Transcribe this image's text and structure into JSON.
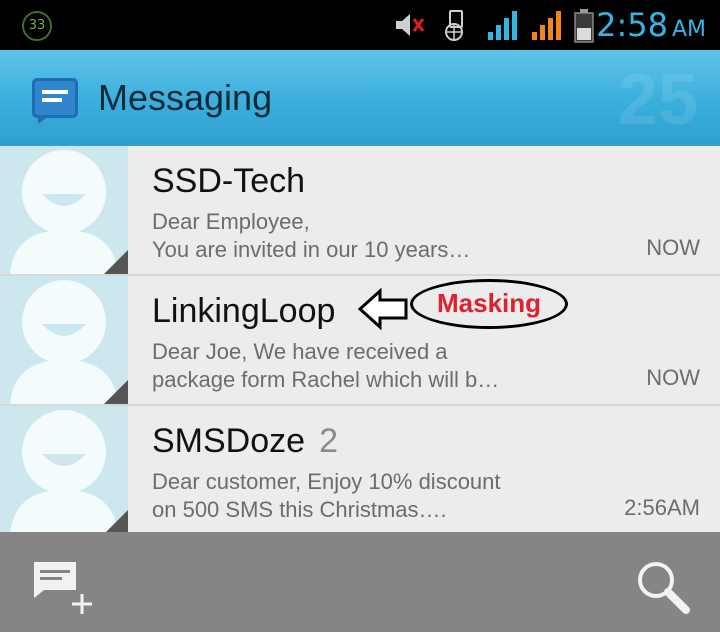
{
  "status_bar": {
    "badge": "33",
    "time": "2:58",
    "ampm": "AM",
    "icons": [
      "mute-icon",
      "data-icon",
      "signal-1-icon",
      "signal-2-icon",
      "battery-icon"
    ]
  },
  "action_bar": {
    "title": "Messaging",
    "ghost_count": "25",
    "icon": "messaging-app-icon"
  },
  "conversations": [
    {
      "sender": "SSD-Tech",
      "unread": "",
      "preview_line1": "Dear Employee,",
      "preview_line2": "You are invited in our 10 years…",
      "time": "NOW"
    },
    {
      "sender": "LinkingLoop",
      "unread": "",
      "preview_line1": "Dear Joe, We have received a",
      "preview_line2": "package form Rachel which will b…",
      "time": "NOW"
    },
    {
      "sender": "SMSDoze",
      "unread": "2",
      "preview_line1": "Dear customer, Enjoy 10% discount",
      "preview_line2": "on 500 SMS this Christmas….",
      "time": "2:56AM"
    }
  ],
  "annotation": {
    "label": "Masking"
  },
  "bottom_bar": {
    "compose_icon": "new-message-icon",
    "search_icon": "search-icon"
  },
  "colors": {
    "accent": "#33b5e5",
    "action_bar": "#3aaedc",
    "annotation_red": "#e0212b",
    "bottom_bar": "#858585"
  }
}
